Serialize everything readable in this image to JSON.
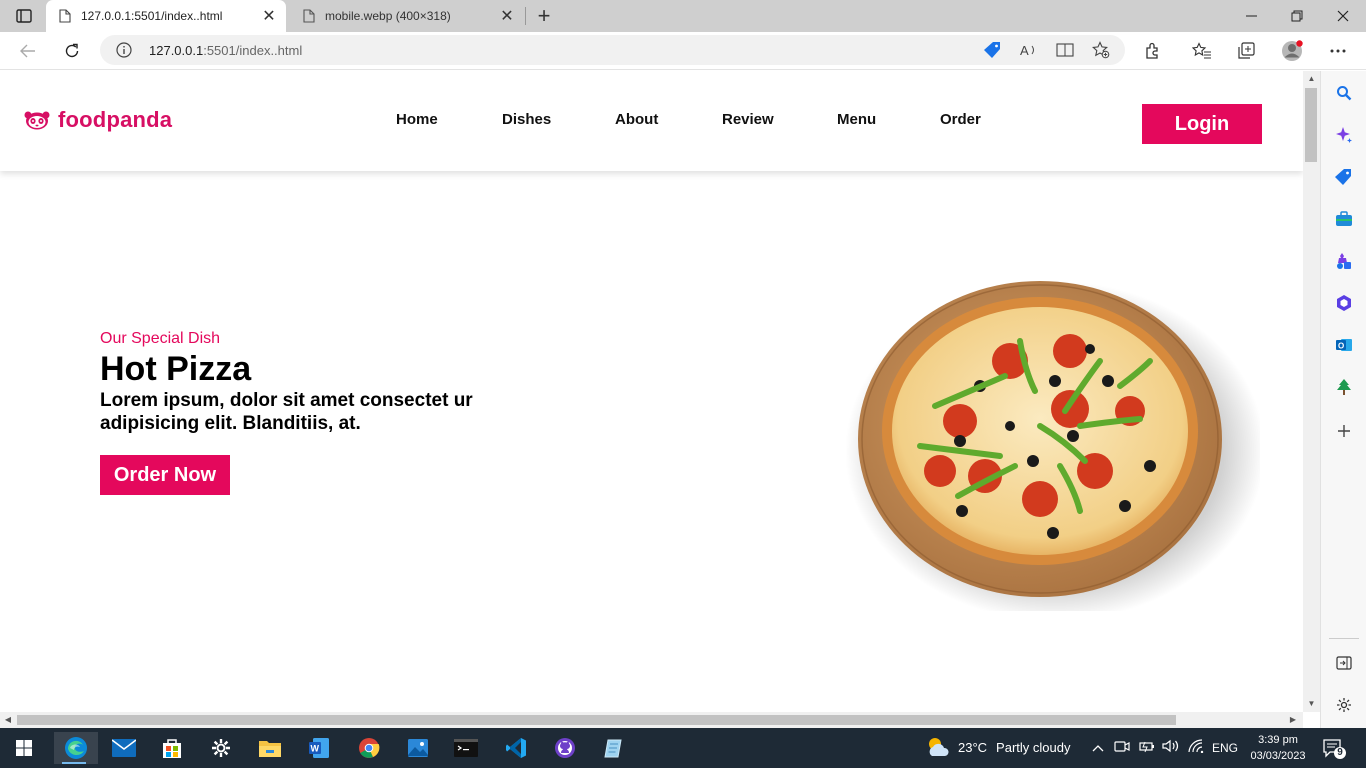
{
  "browser": {
    "tabs": [
      {
        "title": "127.0.0.1:5501/index..html",
        "active": true
      },
      {
        "title": "mobile.webp (400×318)",
        "active": false
      }
    ],
    "url": {
      "host": "127.0.0.1",
      "rest": ":5501/index..html"
    }
  },
  "site": {
    "brand": "foodpanda",
    "nav": [
      "Home",
      "Dishes",
      "About",
      "Review",
      "Menu",
      "Order"
    ],
    "login_label": "Login",
    "hero": {
      "subtitle": "Our Special Dish",
      "title": "Hot Pizza",
      "text": "Lorem ipsum, dolor sit amet consectet ur adipisicing elit. Blanditiis, at.",
      "cta": "Order Now"
    }
  },
  "taskbar": {
    "weather": {
      "temp": "23°C",
      "condition": "Partly cloudy"
    },
    "language": "ENG",
    "time": "3:39 pm",
    "date": "03/03/2023",
    "notifications": "9",
    "apps": [
      "edge-icon",
      "mail-icon",
      "store-icon",
      "settings-icon",
      "file-explorer-icon",
      "word-icon",
      "chrome-icon",
      "photos-icon",
      "terminal-icon",
      "vscode-icon",
      "github-desktop-icon",
      "notepad-icon"
    ]
  },
  "colors": {
    "brand": "#d70f64",
    "accent": "#e4085c",
    "taskbar": "#1e2a36"
  }
}
